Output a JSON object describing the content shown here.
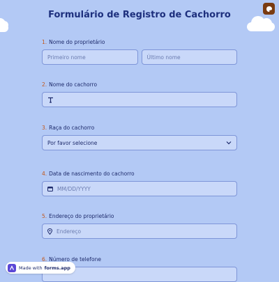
{
  "form": {
    "title": "Formulário de Registro de Cachorro"
  },
  "fields": {
    "owner_name": {
      "number": "1.",
      "label": "Nome do proprietário",
      "first_placeholder": "Primeiro nome",
      "last_placeholder": "Último nome"
    },
    "dog_name": {
      "number": "2.",
      "label": "Nome do cachorro",
      "icon": "text-icon"
    },
    "breed": {
      "number": "3.",
      "label": "Raça do cachorro",
      "selected": "Por favor selecione"
    },
    "birth_date": {
      "number": "4.",
      "label": "Data de nascimento do cachorro",
      "placeholder": "MM/DD/YYYY",
      "icon": "calendar-icon"
    },
    "address": {
      "number": "5.",
      "label": "Endereço do proprietário",
      "placeholder": "Endereço",
      "icon": "location-pin-icon"
    },
    "phone": {
      "number": "6.",
      "label": "Número de telefone"
    }
  },
  "footer": {
    "made_with": "Made with",
    "brand": "forms.app"
  },
  "colors": {
    "background": "#b3c9f5",
    "title": "#1d2f7d",
    "number_accent": "#c2571a",
    "input_fill": "#c9d8f9",
    "corner_button": "#7a3b12"
  }
}
